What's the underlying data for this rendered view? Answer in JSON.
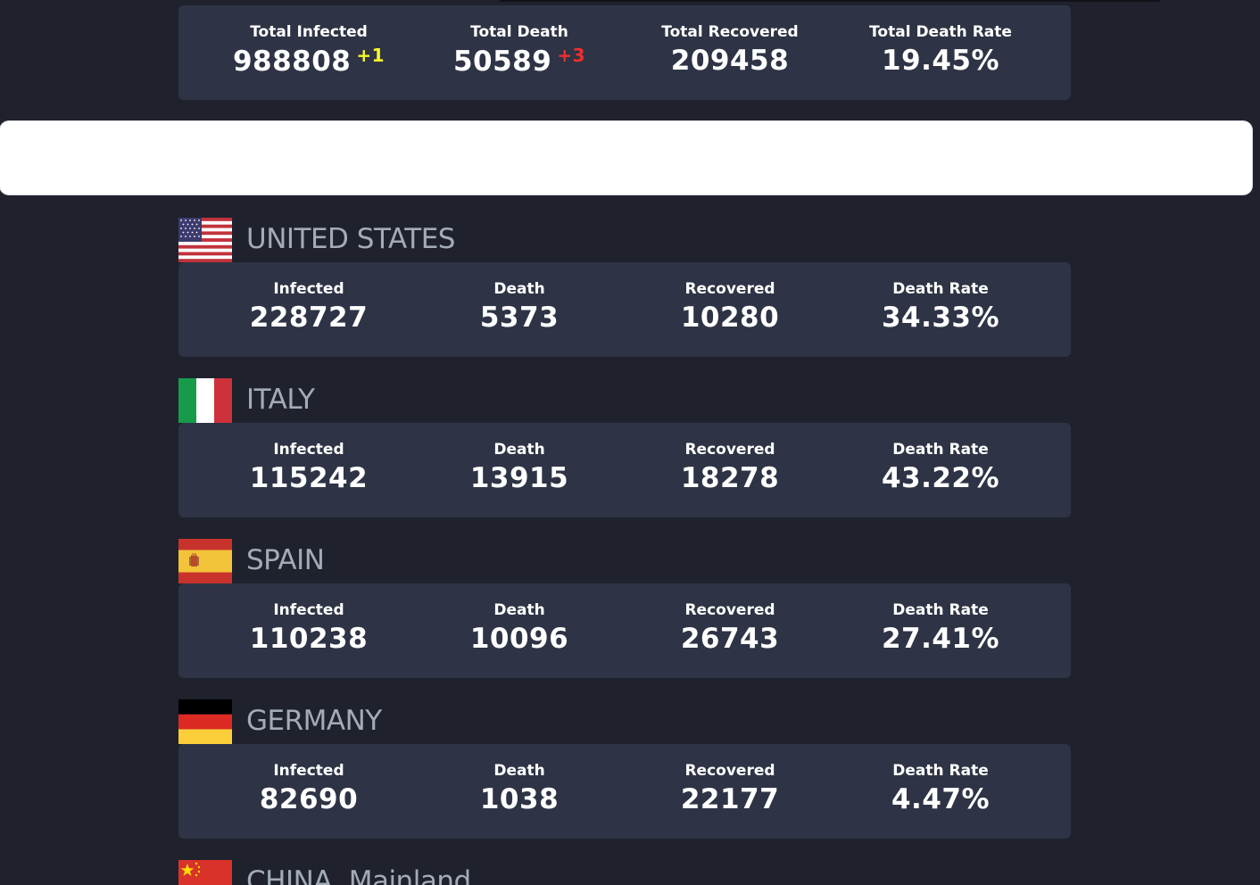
{
  "global": {
    "stats": [
      {
        "label": "Total Infected",
        "value": "988808",
        "delta": "+1",
        "delta_color": "#f7f72c"
      },
      {
        "label": "Total Death",
        "value": "50589",
        "delta": "+3",
        "delta_color": "#ee2e2e"
      },
      {
        "label": "Total Recovered",
        "value": "209458"
      },
      {
        "label": "Total Death Rate",
        "value": "19.45%"
      }
    ]
  },
  "countries": [
    {
      "name": "UNITED STATES",
      "flag": "us-flag-icon",
      "stats": [
        {
          "label": "Infected",
          "value": "228727"
        },
        {
          "label": "Death",
          "value": "5373"
        },
        {
          "label": "Recovered",
          "value": "10280"
        },
        {
          "label": "Death Rate",
          "value": "34.33%"
        }
      ]
    },
    {
      "name": "ITALY",
      "flag": "it-flag-icon",
      "stats": [
        {
          "label": "Infected",
          "value": "115242"
        },
        {
          "label": "Death",
          "value": "13915"
        },
        {
          "label": "Recovered",
          "value": "18278"
        },
        {
          "label": "Death Rate",
          "value": "43.22%"
        }
      ]
    },
    {
      "name": "SPAIN",
      "flag": "es-flag-icon",
      "stats": [
        {
          "label": "Infected",
          "value": "110238"
        },
        {
          "label": "Death",
          "value": "10096"
        },
        {
          "label": "Recovered",
          "value": "26743"
        },
        {
          "label": "Death Rate",
          "value": "27.41%"
        }
      ]
    },
    {
      "name": "GERMANY",
      "flag": "de-flag-icon",
      "stats": [
        {
          "label": "Infected",
          "value": "82690"
        },
        {
          "label": "Death",
          "value": "1038"
        },
        {
          "label": "Recovered",
          "value": "22177"
        },
        {
          "label": "Death Rate",
          "value": "4.47%"
        }
      ]
    },
    {
      "name": "CHINA, Mainland",
      "flag": "cn-flag-icon"
    }
  ],
  "colors": {
    "background": "#1f222d",
    "card": "#2e3445",
    "country_name": "#a3aab8"
  }
}
